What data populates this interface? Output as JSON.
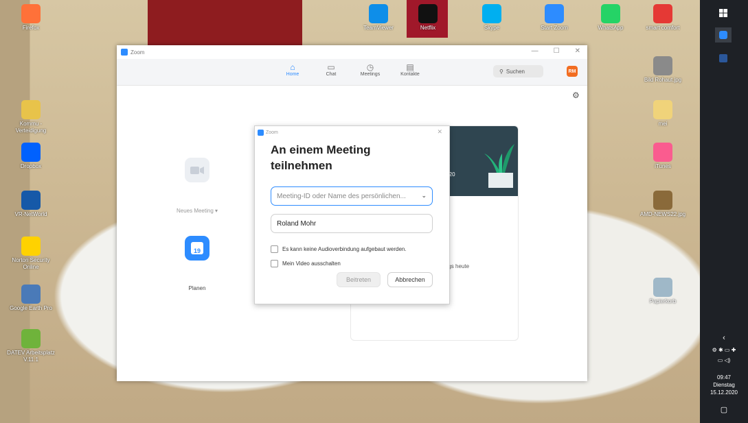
{
  "desktop_icons": [
    {
      "label": "Firefox",
      "color": "#ff7139"
    },
    {
      "label": "TeamViewer",
      "color": "#0e8ee9"
    },
    {
      "label": "Netflix",
      "color": "#111111"
    },
    {
      "label": "Skype",
      "color": "#00aff0"
    },
    {
      "label": "Start Zoom",
      "color": "#2d8cff"
    },
    {
      "label": "WhatsApp",
      "color": "#25d366"
    },
    {
      "label": "smart comfort",
      "color": "#e53935"
    },
    {
      "label": "Bild Rohaut.jpg",
      "color": "#8a8a8a"
    },
    {
      "label": "Kommu - Verteidigung",
      "color": "#e8c34a"
    },
    {
      "label": "mei",
      "color": "#f0d37a"
    },
    {
      "label": "Dropbox",
      "color": "#0061fe"
    },
    {
      "label": "iTunes",
      "color": "#fa5c8f"
    },
    {
      "label": "VR-NetWorld",
      "color": "#1659a8"
    },
    {
      "label": "AMD-NEWS22.jpg",
      "color": "#8a6a3a"
    },
    {
      "label": "Norton Security Online",
      "color": "#ffd200"
    },
    {
      "label": "Google Earth Pro",
      "color": "#4a7ab8"
    },
    {
      "label": "Papierkorb",
      "color": "#9fb8c8"
    },
    {
      "label": "DATEV Arbeitsplatz V.11.1",
      "color": "#6fb33b"
    }
  ],
  "zoom": {
    "window_title": "Zoom",
    "nav": [
      {
        "label": "Home",
        "icon": "home-icon"
      },
      {
        "label": "Chat",
        "icon": "chat-icon"
      },
      {
        "label": "Meetings",
        "icon": "clock-icon"
      },
      {
        "label": "Kontakte",
        "icon": "contacts-icon"
      }
    ],
    "search_placeholder": "Suchen",
    "avatar_initials": "RM",
    "actions": {
      "new_meeting": "Neues Meeting",
      "schedule": "Planen",
      "calendar_day": "19"
    },
    "card": {
      "date_fragment": "ber 2020",
      "meetings_text": "eetings heute"
    }
  },
  "dialog": {
    "title": "Zoom",
    "heading": "An einem Meeting teilnehmen",
    "meeting_placeholder": "Meeting-ID oder Name des persönlichen...",
    "name_value": "Roland Mohr",
    "option_no_audio": "Es kann keine Audioverbindung aufgebaut werden.",
    "option_video_off": "Mein Video ausschalten",
    "join_label": "Beitreten",
    "cancel_label": "Abbrechen"
  },
  "taskbar": {
    "time": "09:47",
    "weekday": "Dienstag",
    "date": "15.12.2020"
  },
  "colors": {
    "accent": "#2d8cff",
    "action_orange": "#f26d21"
  }
}
